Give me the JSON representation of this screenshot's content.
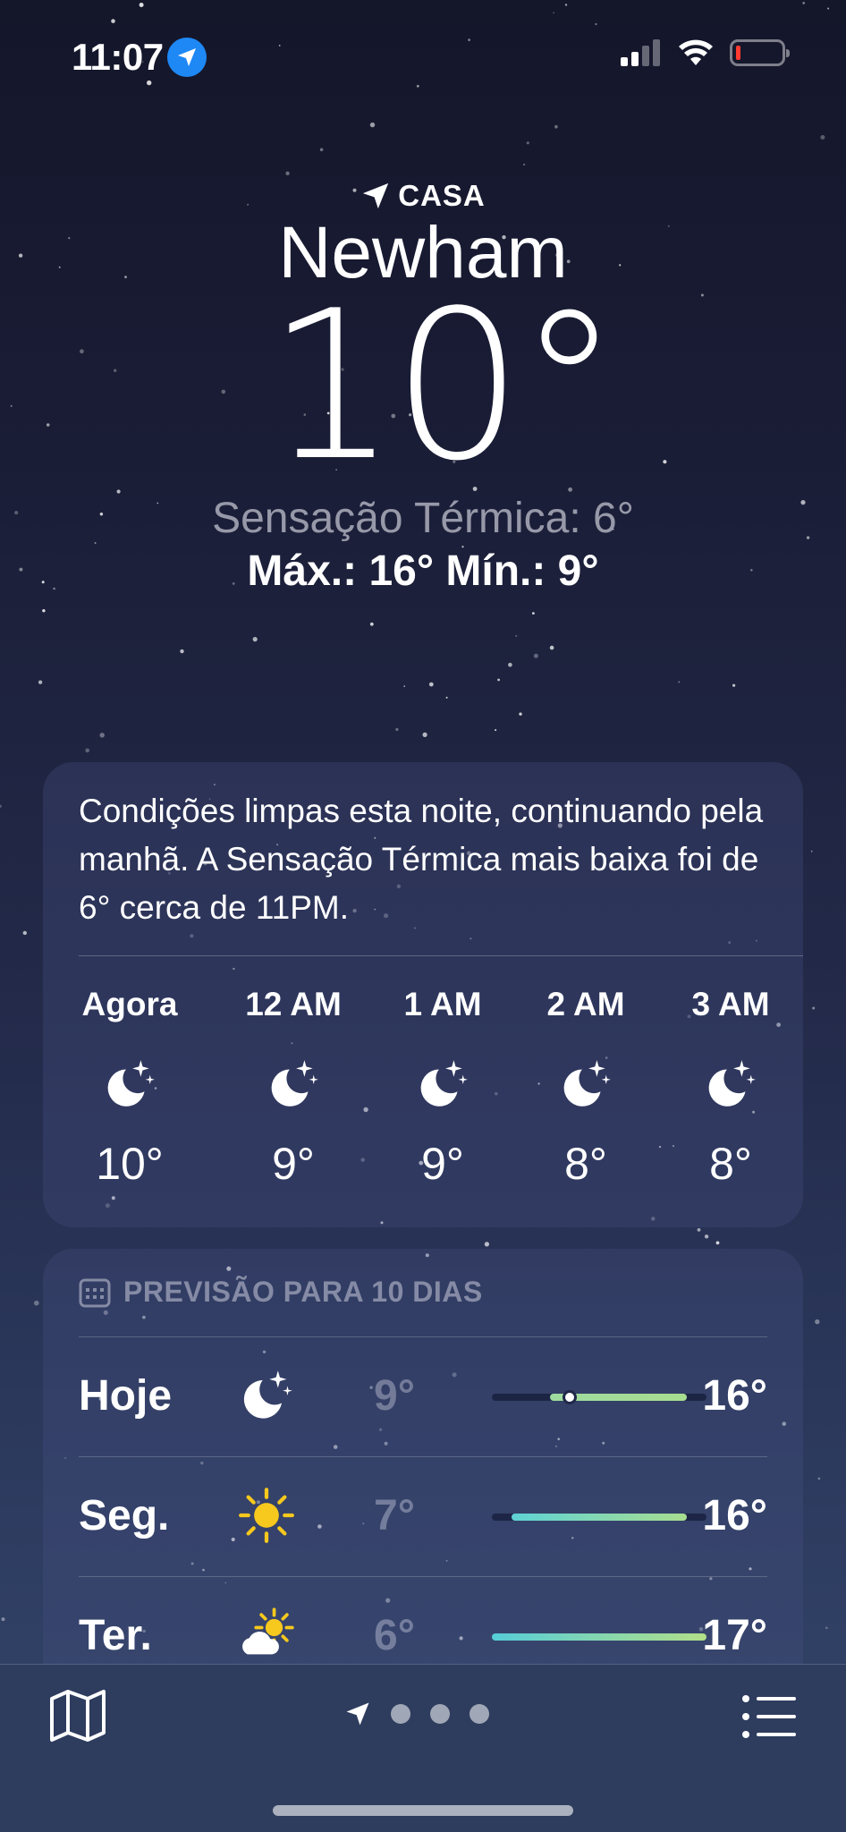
{
  "status_bar": {
    "time": "11:07"
  },
  "location": {
    "label": "CASA",
    "city": "Newham",
    "temperature": "10°",
    "feels_like": "Sensação Térmica: 6°",
    "high_low": "Máx.: 16°  Mín.: 9°"
  },
  "summary": {
    "text": "Condições limpas esta noite, continuando pela manhã. A Sensação Térmica mais baixa foi de 6° cerca de 11PM."
  },
  "hourly": [
    {
      "label": "Agora",
      "icon": "moon-stars-icon",
      "temp": "10°"
    },
    {
      "label": "12 AM",
      "icon": "moon-stars-icon",
      "temp": "9°"
    },
    {
      "label": "1 AM",
      "icon": "moon-stars-icon",
      "temp": "9°"
    },
    {
      "label": "2 AM",
      "icon": "moon-stars-icon",
      "temp": "8°"
    },
    {
      "label": "3 AM",
      "icon": "moon-stars-icon",
      "temp": "8°"
    }
  ],
  "forecast": {
    "header": "PREVISÃO PARA 10 DIAS",
    "range_min": 6,
    "range_max": 17,
    "days": [
      {
        "day": "Hoje",
        "icon": "moon-stars-icon",
        "low": "9°",
        "high": "16°",
        "low_value": 9,
        "high_value": 16,
        "current_value": 10,
        "bar_colors": [
          "#9edba0",
          "#a8dd8f"
        ]
      },
      {
        "day": "Seg.",
        "icon": "sun-icon",
        "low": "7°",
        "high": "16°",
        "low_value": 7,
        "high_value": 16,
        "bar_colors": [
          "#5fd3d6",
          "#a8dd8f"
        ]
      },
      {
        "day": "Ter.",
        "icon": "partly-sunny-icon",
        "low": "6°",
        "high": "17°",
        "low_value": 6,
        "high_value": 17,
        "bar_colors": [
          "#56cdd8",
          "#b2df88"
        ]
      }
    ]
  },
  "toolbar": {
    "pages": 3
  }
}
